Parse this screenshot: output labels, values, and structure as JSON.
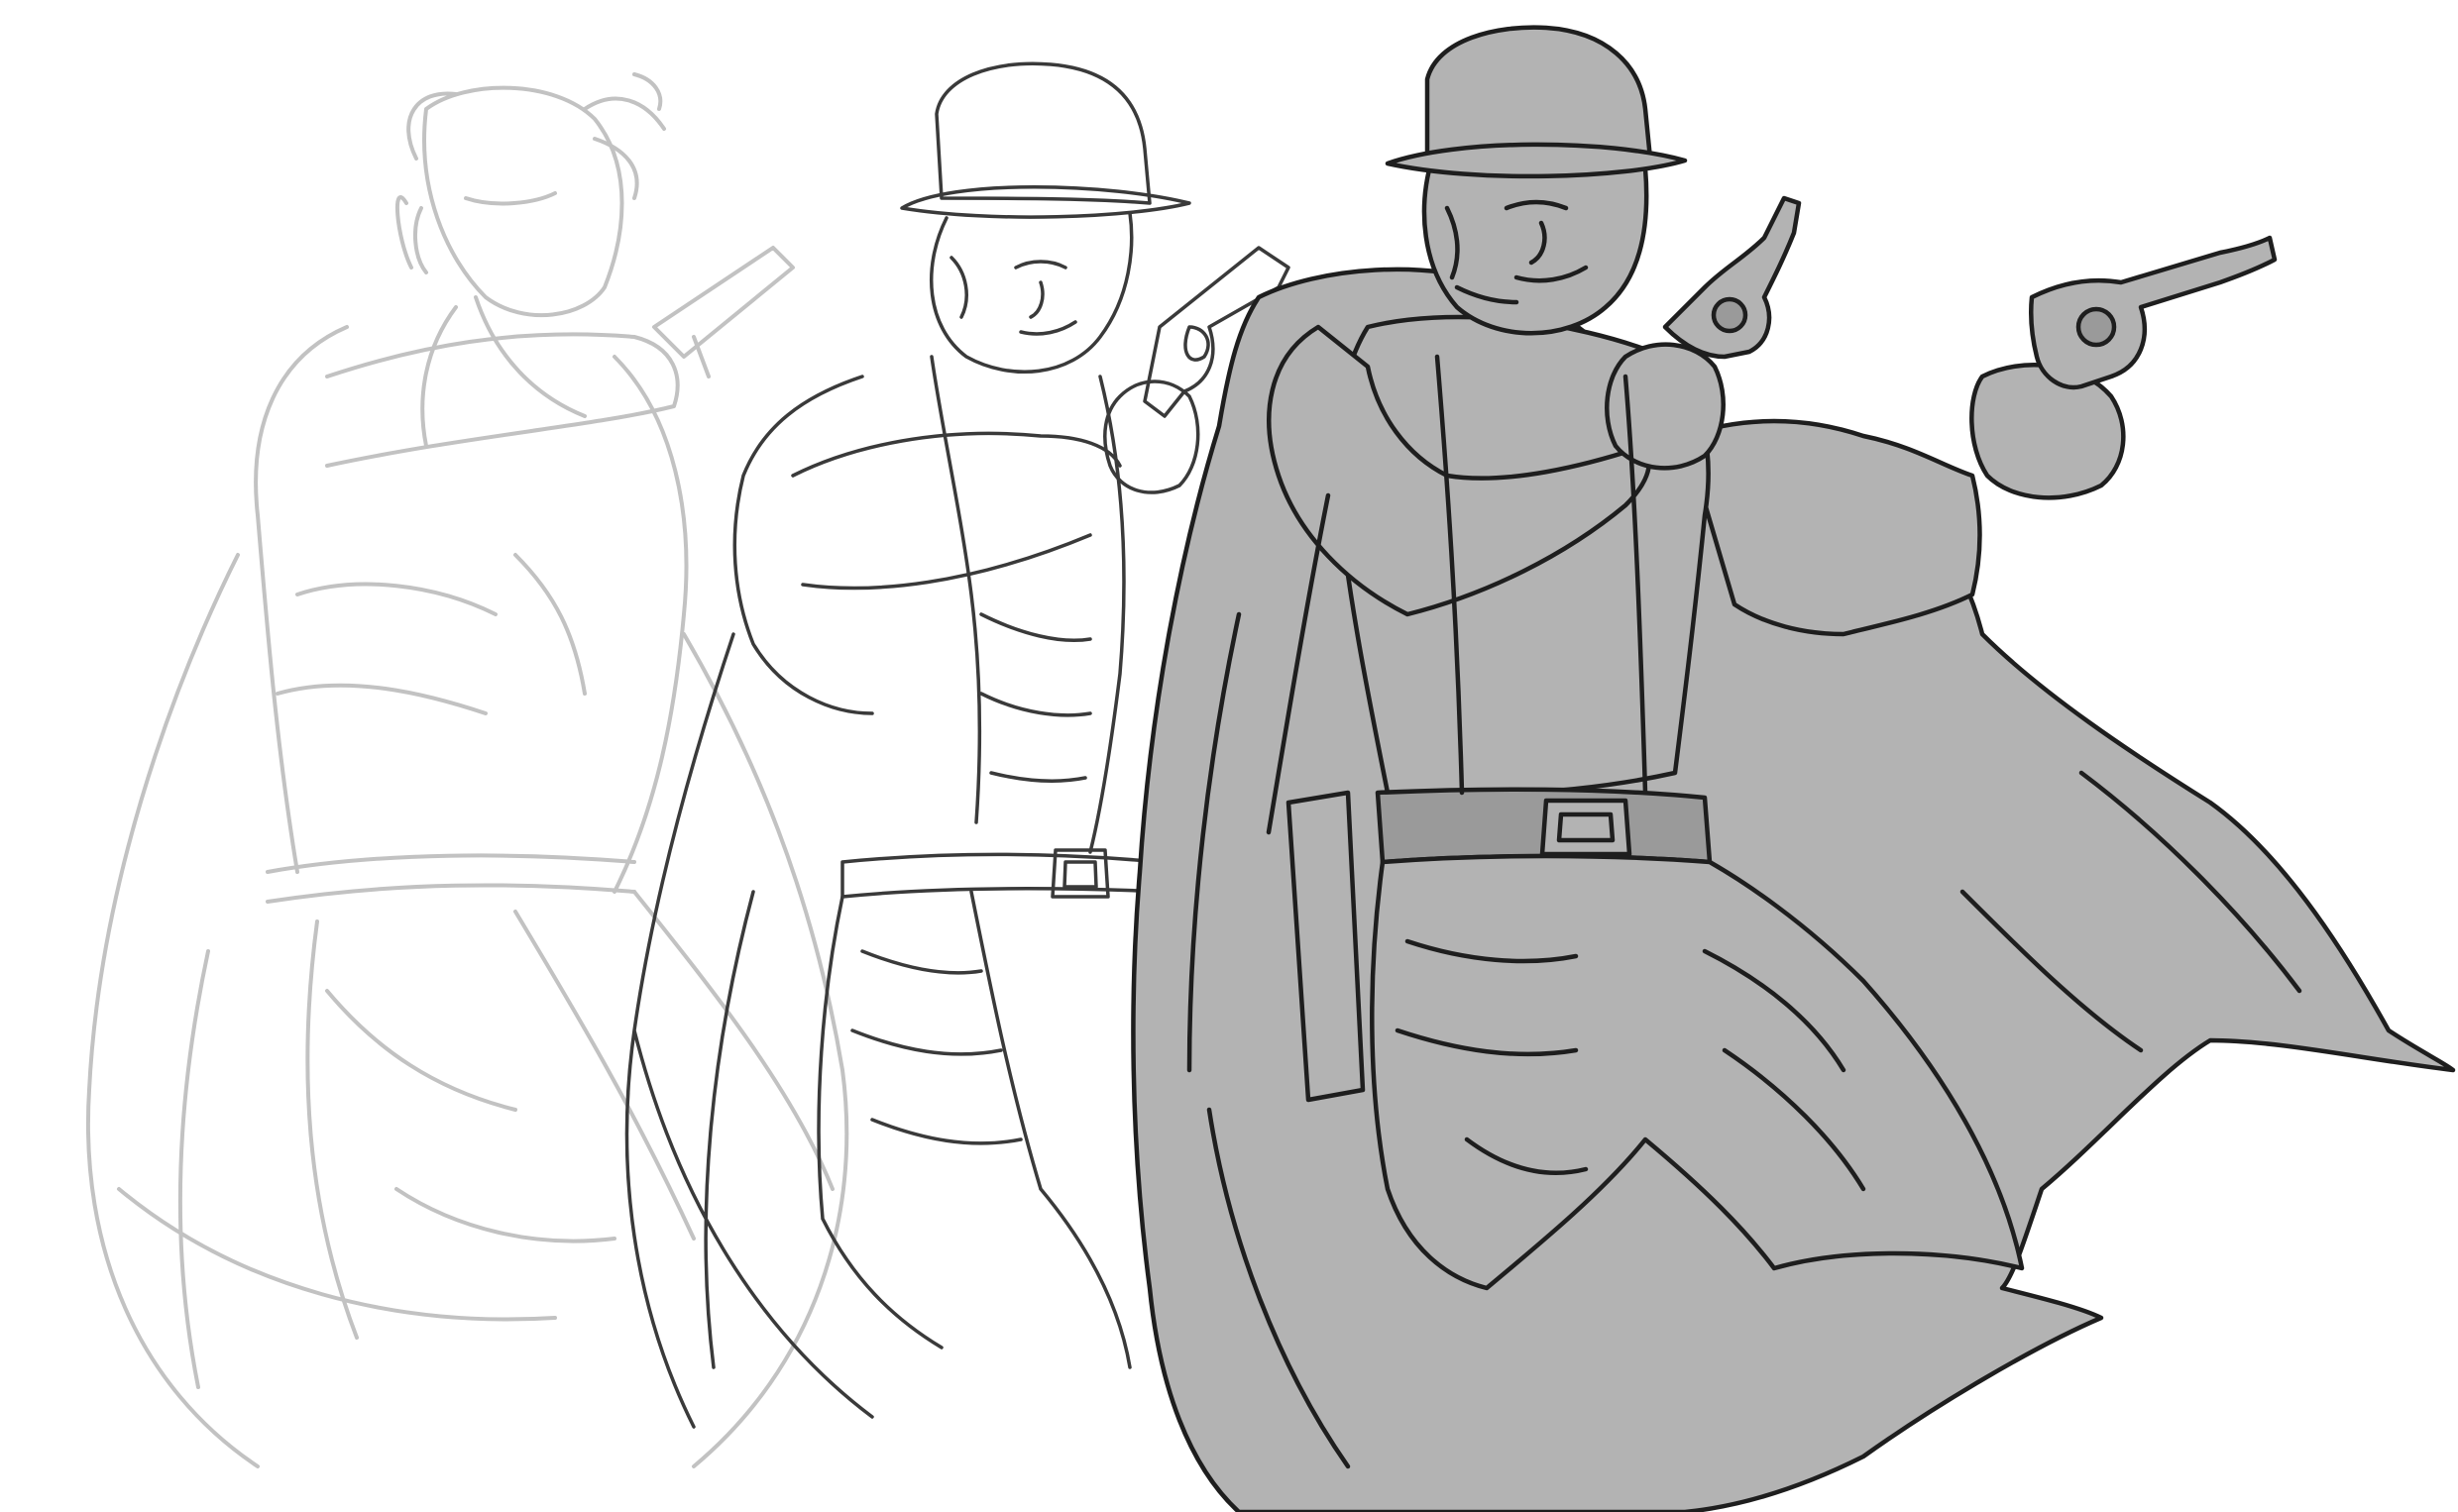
{
  "artwork": {
    "stages": [
      {
        "id": "rough-sketch",
        "style": "light grey loose construction lines"
      },
      {
        "id": "tight-pencils",
        "style": "dark grey line drawing"
      },
      {
        "id": "flat-fill",
        "style": "clean ink lines with flat grey fill"
      }
    ],
    "colors": {
      "background": "#ffffff",
      "rough_line": "#c2c2c2",
      "pencil_line": "#3a3a3a",
      "ink_line": "#1e1e1e",
      "flat_fill": "#b3b3b3",
      "belt_fill": "#9a9a9a"
    }
  }
}
